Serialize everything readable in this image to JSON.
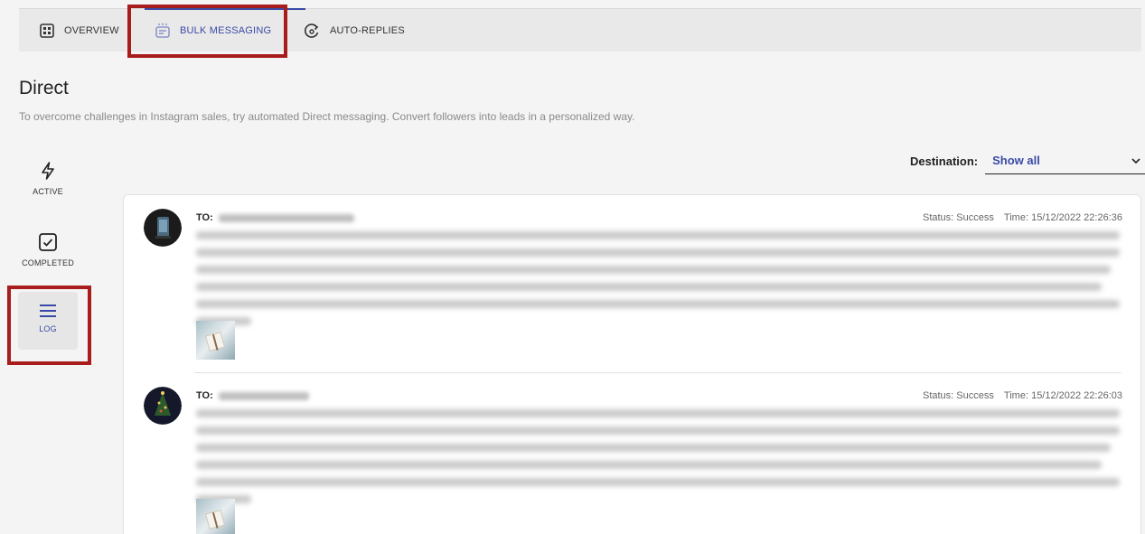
{
  "tabs": [
    {
      "label": "OVERVIEW",
      "icon": "dashboard-icon"
    },
    {
      "label": "BULK MESSAGING",
      "icon": "bulk-messaging-icon",
      "active": true
    },
    {
      "label": "AUTO-REPLIES",
      "icon": "auto-reply-icon"
    }
  ],
  "page": {
    "title": "Direct",
    "subtitle": "To overcome challenges in Instagram sales, try automated Direct messaging. Convert followers into leads in a personalized way."
  },
  "nav": [
    {
      "label": "ACTIVE",
      "icon": "lightning-icon"
    },
    {
      "label": "COMPLETED",
      "icon": "checkbox-icon"
    },
    {
      "label": "LOG",
      "icon": "menu-icon",
      "active": true
    }
  ],
  "destination": {
    "label": "Destination:",
    "value": "Show all"
  },
  "log": {
    "entries": [
      {
        "to_label": "TO:",
        "status": "Status: Success",
        "time": "Time: 15/12/2022 22:26:36"
      },
      {
        "to_label": "TO:",
        "status": "Status: Success",
        "time": "Time: 15/12/2022 22:26:03"
      }
    ]
  },
  "colors": {
    "accent": "#3a4aa6",
    "highlight": "#a81c1c",
    "background": "#f4f4f4"
  }
}
